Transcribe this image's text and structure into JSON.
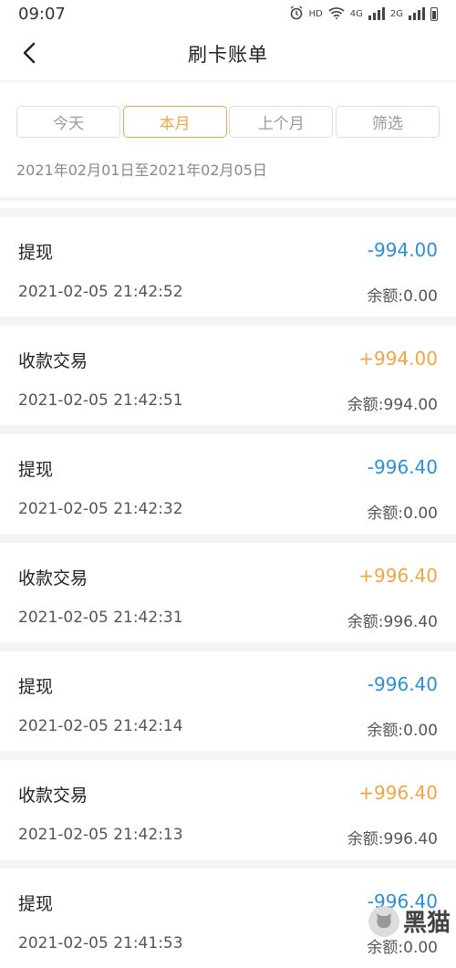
{
  "status_bar": {
    "time": "09:07",
    "hd": "HD",
    "net1": "4G",
    "net2": "2G"
  },
  "header": {
    "title": "刷卡账单"
  },
  "filters": {
    "tabs": [
      {
        "label": "今天",
        "active": false
      },
      {
        "label": "本月",
        "active": true
      },
      {
        "label": "上个月",
        "active": false
      },
      {
        "label": "筛选",
        "active": false
      }
    ],
    "date_range": "2021年02月01日至2021年02月05日"
  },
  "records": [
    {
      "type": "提现",
      "amount": "-994.00",
      "time": "2021-02-05 21:42:52",
      "balance": "余额:0.00"
    },
    {
      "type": "收款交易",
      "amount": "+994.00",
      "time": "2021-02-05 21:42:51",
      "balance": "余额:994.00"
    },
    {
      "type": "提现",
      "amount": "-996.40",
      "time": "2021-02-05 21:42:32",
      "balance": "余额:0.00"
    },
    {
      "type": "收款交易",
      "amount": "+996.40",
      "time": "2021-02-05 21:42:31",
      "balance": "余额:996.40"
    },
    {
      "type": "提现",
      "amount": "-996.40",
      "time": "2021-02-05 21:42:14",
      "balance": "余额:0.00"
    },
    {
      "type": "收款交易",
      "amount": "+996.40",
      "time": "2021-02-05 21:42:13",
      "balance": "余额:996.40"
    },
    {
      "type": "提现",
      "amount": "-996.40",
      "time": "2021-02-05 21:41:53",
      "balance": "余额:0.00"
    }
  ],
  "watermark": {
    "text": "黑猫"
  },
  "colors": {
    "accent": "#f0a646",
    "negative": "#2d8fd8",
    "positive": "#f0a646"
  }
}
